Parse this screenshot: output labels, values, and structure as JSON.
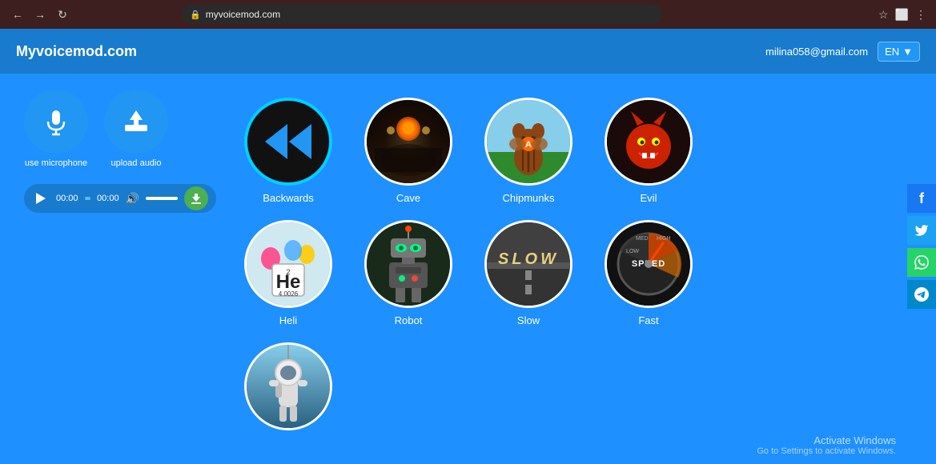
{
  "browser": {
    "url": "myvoicemod.com",
    "back_label": "←",
    "forward_label": "→",
    "reload_label": "↻",
    "star_icon": "★",
    "ext_icon": "⬜"
  },
  "header": {
    "logo": "Myvoicemod.com",
    "email": "milina058@gmail.com",
    "lang": "EN",
    "lang_arrow": "▼"
  },
  "audio_player": {
    "time_current": "00:00",
    "time_total": "00:00"
  },
  "controls": {
    "use_microphone": "use microphone",
    "upload_audio": "upload audio"
  },
  "effects": [
    {
      "id": "backwards",
      "label": "Backwards",
      "active": true
    },
    {
      "id": "cave",
      "label": "Cave",
      "active": false
    },
    {
      "id": "chipmunks",
      "label": "Chipmunks",
      "active": false
    },
    {
      "id": "evil",
      "label": "Evil",
      "active": false
    },
    {
      "id": "heli",
      "label": "Heli",
      "active": false
    },
    {
      "id": "robot",
      "label": "Robot",
      "active": false
    },
    {
      "id": "slow",
      "label": "Slow",
      "active": false
    },
    {
      "id": "fast",
      "label": "Fast",
      "active": false
    },
    {
      "id": "astronaut",
      "label": "",
      "active": false
    }
  ],
  "social": {
    "facebook": "f",
    "twitter": "t",
    "whatsapp": "w",
    "telegram": "✈"
  },
  "activate": {
    "title": "Activate Windows",
    "subtitle": "Go to Settings to activate Windows."
  }
}
